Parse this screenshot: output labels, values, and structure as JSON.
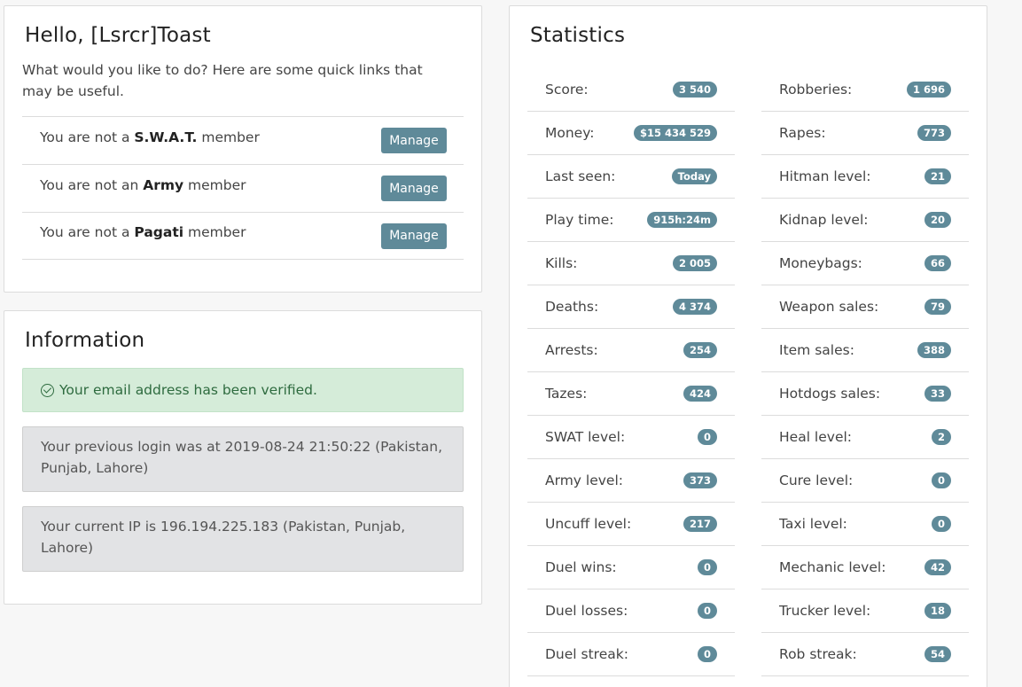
{
  "hello": {
    "title": "Hello, [Lsrcr]Toast",
    "intro": "What would you like to do? Here are some quick links that may be useful.",
    "memberships": [
      {
        "prefix": "You are not a ",
        "group": "S.W.A.T.",
        "suffix": " member",
        "button": "Manage"
      },
      {
        "prefix": "You are not an ",
        "group": "Army",
        "suffix": " member",
        "button": "Manage"
      },
      {
        "prefix": "You are not a ",
        "group": "Pagati",
        "suffix": " member",
        "button": "Manage"
      }
    ]
  },
  "information": {
    "title": "Information",
    "email_verified": "Your email address has been verified.",
    "previous_login": "Your previous login was at 2019-08-24 21:50:22 (Pakistan, Punjab, Lahore)",
    "current_ip": "Your current IP is 196.194.225.183 (Pakistan, Punjab, Lahore)"
  },
  "statistics": {
    "title": "Statistics",
    "left": [
      {
        "label": "Score:",
        "value": "3 540"
      },
      {
        "label": "Money:",
        "value": "$15 434 529"
      },
      {
        "label": "Last seen:",
        "value": "Today"
      },
      {
        "label": "Play time:",
        "value": "915h:24m"
      },
      {
        "label": "Kills:",
        "value": "2 005"
      },
      {
        "label": "Deaths:",
        "value": "4 374"
      },
      {
        "label": "Arrests:",
        "value": "254"
      },
      {
        "label": "Tazes:",
        "value": "424"
      },
      {
        "label": "SWAT level:",
        "value": "0"
      },
      {
        "label": "Army level:",
        "value": "373"
      },
      {
        "label": "Uncuff level:",
        "value": "217"
      },
      {
        "label": "Duel wins:",
        "value": "0"
      },
      {
        "label": "Duel losses:",
        "value": "0"
      },
      {
        "label": "Duel streak:",
        "value": "0"
      }
    ],
    "right": [
      {
        "label": "Robberies:",
        "value": "1 696"
      },
      {
        "label": "Rapes:",
        "value": "773"
      },
      {
        "label": "Hitman level:",
        "value": "21"
      },
      {
        "label": "Kidnap level:",
        "value": "20"
      },
      {
        "label": "Moneybags:",
        "value": "66"
      },
      {
        "label": "Weapon sales:",
        "value": "79"
      },
      {
        "label": "Item sales:",
        "value": "388"
      },
      {
        "label": "Hotdogs sales:",
        "value": "33"
      },
      {
        "label": "Heal level:",
        "value": "2"
      },
      {
        "label": "Cure level:",
        "value": "0"
      },
      {
        "label": "Taxi level:",
        "value": "0"
      },
      {
        "label": "Mechanic level:",
        "value": "42"
      },
      {
        "label": "Trucker level:",
        "value": "18"
      },
      {
        "label": "Rob streak:",
        "value": "54"
      }
    ]
  },
  "colors": {
    "accent": "#5f8a99",
    "success_bg": "#d5ecd9",
    "info_bg": "#e2e3e5"
  }
}
